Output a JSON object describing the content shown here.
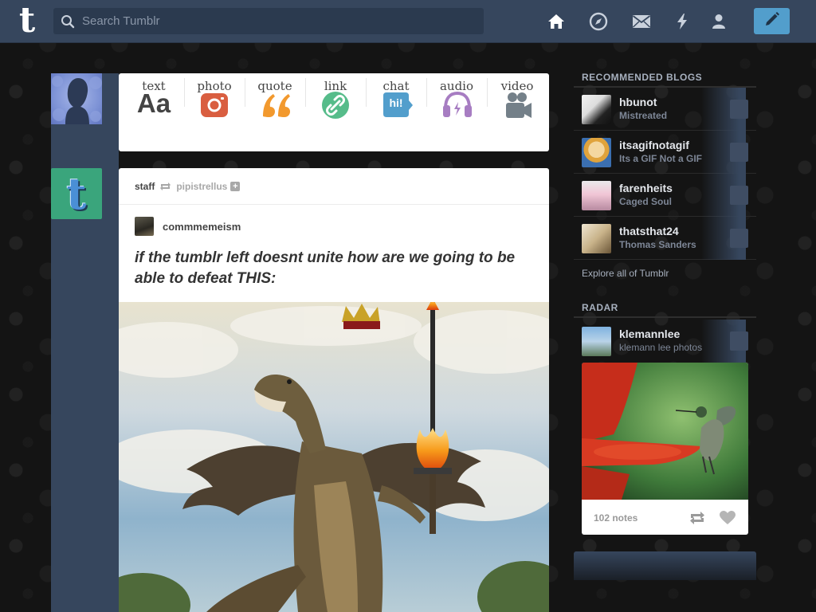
{
  "header": {
    "logo": "t",
    "search_placeholder": "Search Tumblr",
    "nav": [
      {
        "name": "home-icon"
      },
      {
        "name": "explore-icon"
      },
      {
        "name": "mail-icon"
      },
      {
        "name": "activity-icon"
      },
      {
        "name": "account-icon"
      }
    ],
    "compose_icon": "pencil-icon",
    "color_bar": "#36465d",
    "color_accent": "#529ecc"
  },
  "post_types": [
    {
      "label": "text",
      "glyph": "Aa",
      "color": "#444444"
    },
    {
      "label": "photo",
      "color": "#d95e40"
    },
    {
      "label": "quote",
      "color": "#f2992e"
    },
    {
      "label": "link",
      "color": "#56bc8a"
    },
    {
      "label": "chat",
      "glyph": "hi!",
      "color": "#529ecc"
    },
    {
      "label": "audio",
      "color": "#a77dc2"
    },
    {
      "label": "video",
      "color": "#748089"
    }
  ],
  "post": {
    "author": "staff",
    "source": "pipistrellus",
    "reblogger": "commmemeism",
    "text": "if the tumblr left doesnt unite how are we going to be able to defeat THIS:"
  },
  "sidebar": {
    "recommended_title": "RECOMMENDED BLOGS",
    "blogs": [
      {
        "name": "hbunot",
        "desc": "Mistreated"
      },
      {
        "name": "itsagifnotagif",
        "desc": "Its a GIF Not a GIF"
      },
      {
        "name": "farenheits",
        "desc": "Caged Soul"
      },
      {
        "name": "thatsthat24",
        "desc": "Thomas Sanders"
      }
    ],
    "explore": "Explore all of Tumblr",
    "radar_title": "RADAR",
    "radar": {
      "name": "klemannlee",
      "desc": "klemann lee photos",
      "notes": "102 notes"
    }
  }
}
